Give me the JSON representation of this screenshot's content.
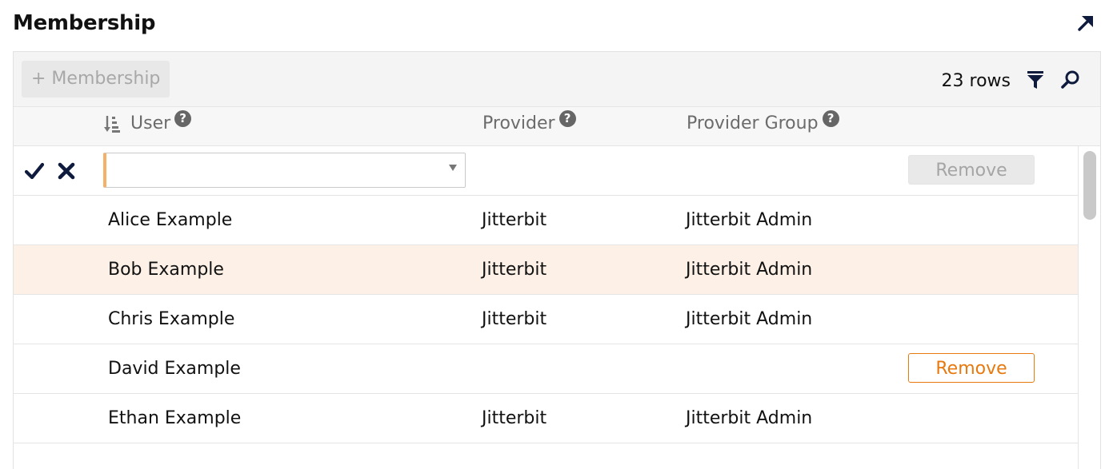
{
  "header": {
    "title": "Membership",
    "expand_icon": "arrow-up-right-icon"
  },
  "toolbar": {
    "add_label": "+ Membership",
    "row_count": "23 rows",
    "filter_icon": "filter-icon",
    "search_icon": "search-icon"
  },
  "columns": {
    "user": "User",
    "provider": "Provider",
    "provider_group": "Provider Group",
    "help_glyph": "?"
  },
  "edit_row": {
    "confirm_icon": "checkmark-icon",
    "cancel_icon": "cross-icon",
    "user_value": "",
    "remove_label": "Remove"
  },
  "rows": [
    {
      "user": "Alice Example",
      "provider": "Jitterbit",
      "group": "Jitterbit Admin",
      "remove_label": "",
      "highlighted": false
    },
    {
      "user": "Bob Example",
      "provider": "Jitterbit",
      "group": "Jitterbit Admin",
      "remove_label": "",
      "highlighted": true
    },
    {
      "user": "Chris Example",
      "provider": "Jitterbit",
      "group": "Jitterbit Admin",
      "remove_label": "",
      "highlighted": false
    },
    {
      "user": "David Example",
      "provider": "",
      "group": "",
      "remove_label": "Remove",
      "highlighted": false
    },
    {
      "user": "Ethan Example",
      "provider": "Jitterbit",
      "group": "Jitterbit Admin",
      "remove_label": "",
      "highlighted": false
    }
  ],
  "colors": {
    "accent": "#e8790f",
    "highlight_row": "#fdf1e7",
    "select_edge": "#f5b16a"
  }
}
